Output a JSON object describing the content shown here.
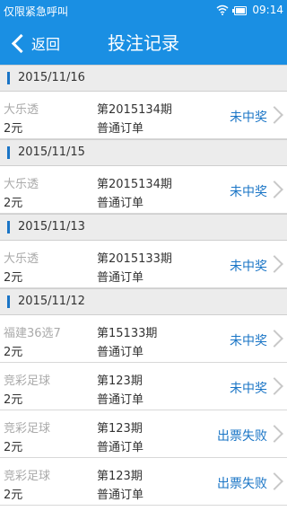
{
  "status_bar": {
    "left_text": "仅限紧急呼叫",
    "time": "09:14",
    "icons": [
      "wifi-icon",
      "battery-icon"
    ]
  },
  "nav": {
    "back_label": "返回",
    "title": "投注记录"
  },
  "colors": {
    "accent": "#1a8fe3",
    "status_text": "#1a75c6"
  },
  "groups": [
    {
      "date": "2015/11/16",
      "records": [
        {
          "lottery": "大乐透",
          "amount": "2元",
          "issue": "第2015134期",
          "order_type": "普通订单",
          "status": "未中奖"
        }
      ]
    },
    {
      "date": "2015/11/15",
      "records": [
        {
          "lottery": "大乐透",
          "amount": "2元",
          "issue": "第2015134期",
          "order_type": "普通订单",
          "status": "未中奖"
        }
      ]
    },
    {
      "date": "2015/11/13",
      "records": [
        {
          "lottery": "大乐透",
          "amount": "2元",
          "issue": "第2015133期",
          "order_type": "普通订单",
          "status": "未中奖"
        }
      ]
    },
    {
      "date": "2015/11/12",
      "records": [
        {
          "lottery": "福建36选7",
          "amount": "2元",
          "issue": "第15133期",
          "order_type": "普通订单",
          "status": "未中奖"
        },
        {
          "lottery": "竞彩足球",
          "amount": "2元",
          "issue": "第123期",
          "order_type": "普通订单",
          "status": "未中奖"
        },
        {
          "lottery": "竞彩足球",
          "amount": "2元",
          "issue": "第123期",
          "order_type": "普通订单",
          "status": "出票失败"
        },
        {
          "lottery": "竞彩足球",
          "amount": "2元",
          "issue": "第123期",
          "order_type": "普通订单",
          "status": "出票失败"
        }
      ]
    }
  ]
}
